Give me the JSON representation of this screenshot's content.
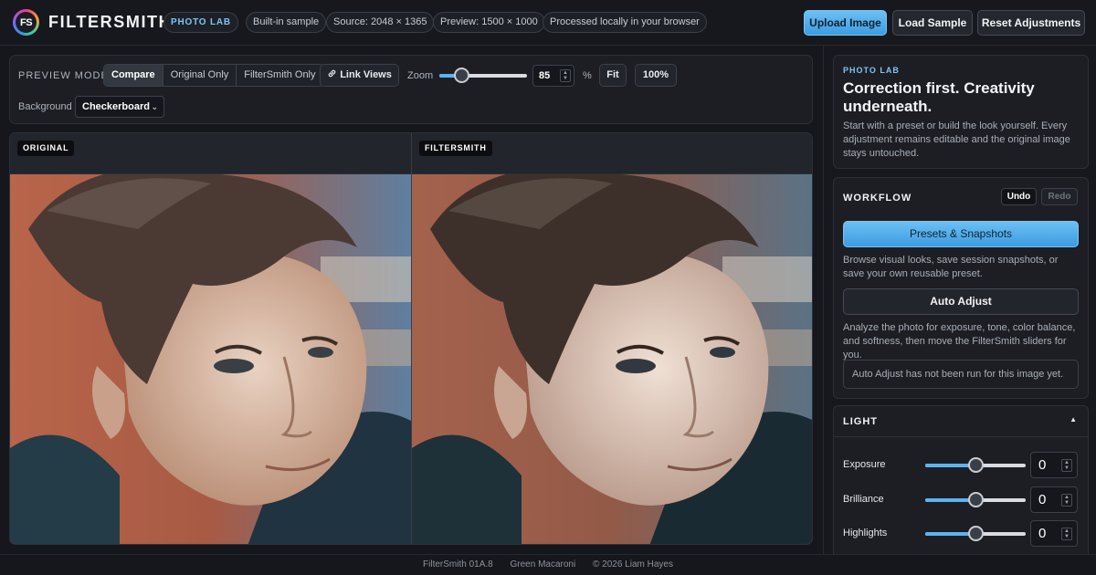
{
  "header": {
    "logo_text": "FS",
    "app_name": "FILTERSMITH",
    "badge": "PHOTO LAB",
    "chips": [
      "Built-in sample",
      "Source: 2048 × 1365",
      "Preview: 1500 × 1000",
      "Processed locally in your browser"
    ],
    "upload_label": "Upload Image",
    "load_sample_label": "Load Sample",
    "reset_label": "Reset Adjustments"
  },
  "toolbar": {
    "preview_mode_label": "PREVIEW MODE",
    "modes": [
      "Compare",
      "Original Only",
      "FilterSmith Only"
    ],
    "active_mode": "Compare",
    "link_views_label": "Link Views",
    "zoom_label": "Zoom",
    "zoom_value": "85",
    "zoom_fraction": 0.25,
    "zoom_unit": "%",
    "fit_label": "Fit",
    "hundred_label": "100%",
    "background_label": "Background",
    "background_value": "Checkerboard"
  },
  "preview": {
    "original_label": "ORIGINAL",
    "filtered_label": "FILTERSMITH"
  },
  "sidebar": {
    "hero": {
      "eyebrow": "PHOTO LAB",
      "title": "Correction first. Creativity underneath.",
      "description": "Start with a preset or build the look yourself. Every adjustment remains editable and the original image stays untouched."
    },
    "workflow": {
      "title": "WORKFLOW",
      "undo_label": "Undo",
      "redo_label": "Redo",
      "presets_label": "Presets & Snapshots",
      "presets_desc": "Browse visual looks, save session snapshots, or save your own reusable preset.",
      "auto_label": "Auto Adjust",
      "auto_desc": "Analyze the photo for exposure, tone, color balance, and softness, then move the FilterSmith sliders for you.",
      "auto_status": "Auto Adjust has not been run for this image yet."
    },
    "light": {
      "title": "LIGHT",
      "adjustments": [
        {
          "label": "Exposure",
          "value": "0",
          "level": 0.5
        },
        {
          "label": "Brilliance",
          "value": "0",
          "level": 0.5
        },
        {
          "label": "Highlights",
          "value": "0",
          "level": 0.5
        }
      ]
    }
  },
  "footer": {
    "version": "FilterSmith 01A.8",
    "build": "Green Macaroni",
    "copyright": "© 2026 Liam Hayes"
  },
  "colors": {
    "accent": "#5cb3ee",
    "background": "#15171c",
    "panel": "#1c1e24"
  }
}
